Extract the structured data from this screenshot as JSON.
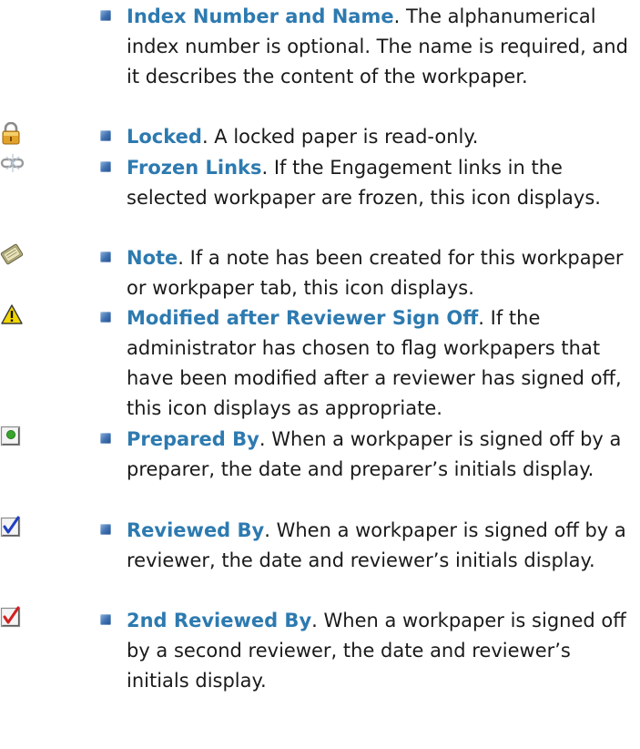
{
  "items": [
    {
      "icon": "none",
      "term": "Index Number and Name",
      "desc": ". The alphanumerical index number is optional. The name is required, and it describes the content of the workpaper."
    },
    {
      "icon": "lock-icon",
      "term": "Locked",
      "desc": ". A locked paper is read-only."
    },
    {
      "icon": "frozen-links-icon",
      "term": "Frozen Links",
      "desc": ". If the Engagement links in the selected workpaper are frozen, this icon displays."
    },
    {
      "icon": "note-icon",
      "term": "Note",
      "desc": ". If a note has been created for this workpaper or workpaper tab, this icon displays."
    },
    {
      "icon": "warning-icon",
      "term": "Modified after Reviewer Sign Off",
      "desc": ". If the administrator has chosen to flag workpapers that have been modified after a reviewer has signed off, this icon displays as appropriate."
    },
    {
      "icon": "prepared-by-icon",
      "term": "Prepared By",
      "desc": ". When a workpaper is signed off by a preparer, the date and preparer’s initials display."
    },
    {
      "icon": "reviewed-by-check-icon",
      "term": "Reviewed By",
      "desc": ". When a workpaper is signed off by a reviewer, the date and reviewer’s initials display."
    },
    {
      "icon": "second-reviewed-check-icon",
      "term": "2nd Reviewed By",
      "desc": ". When a workpaper is signed off by a second reviewer, the date and reviewer’s initials display."
    }
  ]
}
